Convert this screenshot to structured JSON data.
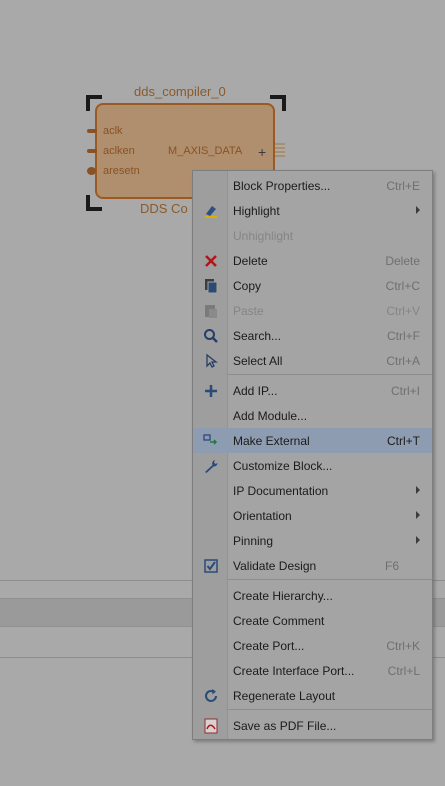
{
  "block": {
    "name": "dds_compiler_0",
    "subtitle": "DDS Co",
    "ports_in": [
      "aclk",
      "aclken",
      "aresetn"
    ],
    "port_out": "M_AXIS_DATA",
    "accent": "#9c5a22"
  },
  "menu": {
    "items": [
      {
        "label": "Block Properties...",
        "shortcut": "Ctrl+E",
        "icon": ""
      },
      {
        "label": "Highlight",
        "shortcut": "",
        "icon": "highlight-icon",
        "submenu": true
      },
      {
        "label": "Unhighlight",
        "shortcut": "",
        "icon": "",
        "disabled": true
      },
      {
        "label": "Delete",
        "shortcut": "Delete",
        "icon": "delete-icon"
      },
      {
        "label": "Copy",
        "shortcut": "Ctrl+C",
        "icon": "copy-icon"
      },
      {
        "label": "Paste",
        "shortcut": "Ctrl+V",
        "icon": "paste-icon",
        "disabled": true
      },
      {
        "label": "Search...",
        "shortcut": "Ctrl+F",
        "icon": "search-icon"
      },
      {
        "label": "Select All",
        "shortcut": "Ctrl+A",
        "icon": "select-all-icon"
      },
      {
        "label": "Add IP...",
        "shortcut": "Ctrl+I",
        "icon": "add-icon"
      },
      {
        "label": "Add Module...",
        "shortcut": "",
        "icon": ""
      },
      {
        "label": "Make External",
        "shortcut": "Ctrl+T",
        "icon": "make-external-icon",
        "highlighted": true
      },
      {
        "label": "Customize Block...",
        "shortcut": "",
        "icon": "wrench-icon"
      },
      {
        "label": "IP Documentation",
        "shortcut": "",
        "icon": "",
        "submenu": true
      },
      {
        "label": "Orientation",
        "shortcut": "",
        "icon": "",
        "submenu": true
      },
      {
        "label": "Pinning",
        "shortcut": "",
        "icon": "",
        "submenu": true
      },
      {
        "label": "Validate Design",
        "shortcut": "F6",
        "icon": "validate-icon"
      },
      {
        "label": "Create Hierarchy...",
        "shortcut": "",
        "icon": ""
      },
      {
        "label": "Create Comment",
        "shortcut": "",
        "icon": ""
      },
      {
        "label": "Create Port...",
        "shortcut": "Ctrl+K",
        "icon": ""
      },
      {
        "label": "Create Interface Port...",
        "shortcut": "Ctrl+L",
        "icon": ""
      },
      {
        "label": "Regenerate Layout",
        "shortcut": "",
        "icon": "regenerate-icon"
      },
      {
        "label": "Save as PDF File...",
        "shortcut": "",
        "icon": "pdf-icon"
      }
    ],
    "highlight_color": "#8e9cb2"
  }
}
